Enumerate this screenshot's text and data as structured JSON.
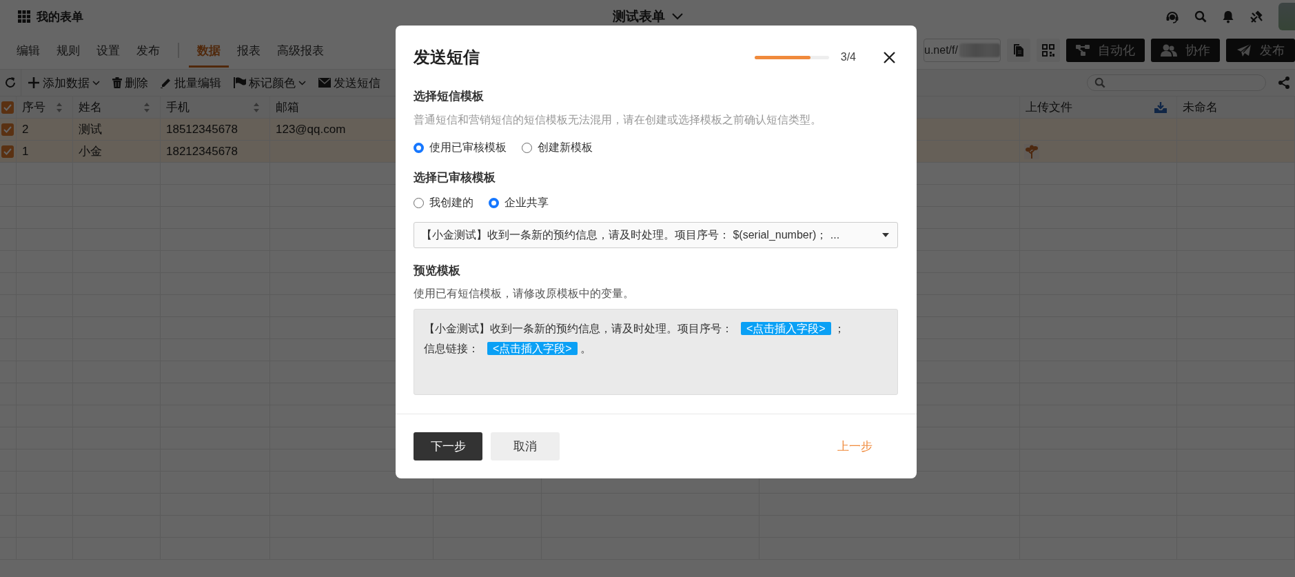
{
  "app": {
    "title": "我的表单",
    "form_title": "测试表单"
  },
  "design_tabs": [
    {
      "label": "编辑",
      "selected": false
    },
    {
      "label": "规则",
      "selected": false
    },
    {
      "label": "设置",
      "selected": false
    },
    {
      "label": "发布",
      "selected": false
    }
  ],
  "data_tabs": [
    {
      "label": "数据",
      "selected": true
    },
    {
      "label": "报表",
      "selected": false
    },
    {
      "label": "高级报表",
      "selected": false
    }
  ],
  "share": {
    "url": "u.net/f/"
  },
  "header_buttons": [
    {
      "kind": "automation",
      "label": "自动化"
    },
    {
      "kind": "team",
      "label": "协作"
    },
    {
      "kind": "send",
      "label": "发布"
    }
  ],
  "toolbar": [
    {
      "kind": "add",
      "label": "添加数据",
      "dropdown": true
    },
    {
      "kind": "delete",
      "label": "删除",
      "dropdown": false
    },
    {
      "kind": "edit",
      "label": "批量编辑",
      "dropdown": false
    },
    {
      "kind": "flag",
      "label": "标记颜色",
      "dropdown": true
    },
    {
      "kind": "mail",
      "label": "发送短信",
      "dropdown": false
    }
  ],
  "table": {
    "all_checked": true,
    "columns": [
      {
        "label": "序号",
        "sortable": true
      },
      {
        "label": "姓名",
        "sortable": true
      },
      {
        "label": "手机",
        "sortable": true
      },
      {
        "label": "邮箱",
        "sortable": false
      },
      {
        "label": "上传文件",
        "sortable": false,
        "download": true
      },
      {
        "label": "未命名",
        "sortable": false,
        "download": false
      }
    ],
    "rows": [
      {
        "checked": true,
        "cells": [
          "2",
          "测试",
          "18512345678",
          "123@qq.com"
        ],
        "file": false
      },
      {
        "checked": true,
        "cells": [
          "1",
          "小金",
          "18212345678"
        ],
        "file": true
      }
    ]
  },
  "dialog": {
    "title": "发送短信",
    "progress": {
      "level": 0.75,
      "step": "3/4"
    },
    "template_heading": "选择短信模板",
    "template_hint": "普通短信和营销短信的短信模板无法混用，请在创建或选择模板之前确认短信类型。",
    "template_mode": [
      {
        "label": "使用已审核模板",
        "selected": true
      },
      {
        "label": "创建新模板",
        "selected": false
      }
    ],
    "approved_heading": "选择已审核模板",
    "approved_source": [
      {
        "label": "我创建的",
        "selected": false
      },
      {
        "label": "企业共享",
        "selected": true
      }
    ],
    "template_select": "【小金测试】收到一条新的预约信息，请及时处理。项目序号： $(serial_number)； ...",
    "preview_heading": "预览模板",
    "preview_hint": "使用已有短信模板，请修改原模板中的变量。",
    "preview": [
      {
        "kind": "text",
        "text": "【小金测试】收到一条新的预约信息，请及时处理。项目序号："
      },
      {
        "kind": "field",
        "text": "<点击插入字段>"
      },
      {
        "kind": "text",
        "text": "；"
      },
      {
        "kind": "break"
      },
      {
        "kind": "text",
        "text": "信息链接："
      },
      {
        "kind": "field",
        "text": "<点击插入字段>"
      },
      {
        "kind": "text",
        "text": "。"
      }
    ],
    "buttons": [
      {
        "kind": "primary",
        "label": "下一步"
      },
      {
        "kind": "secondary",
        "label": "取消"
      },
      {
        "kind": "link",
        "label": "上一步"
      }
    ]
  }
}
